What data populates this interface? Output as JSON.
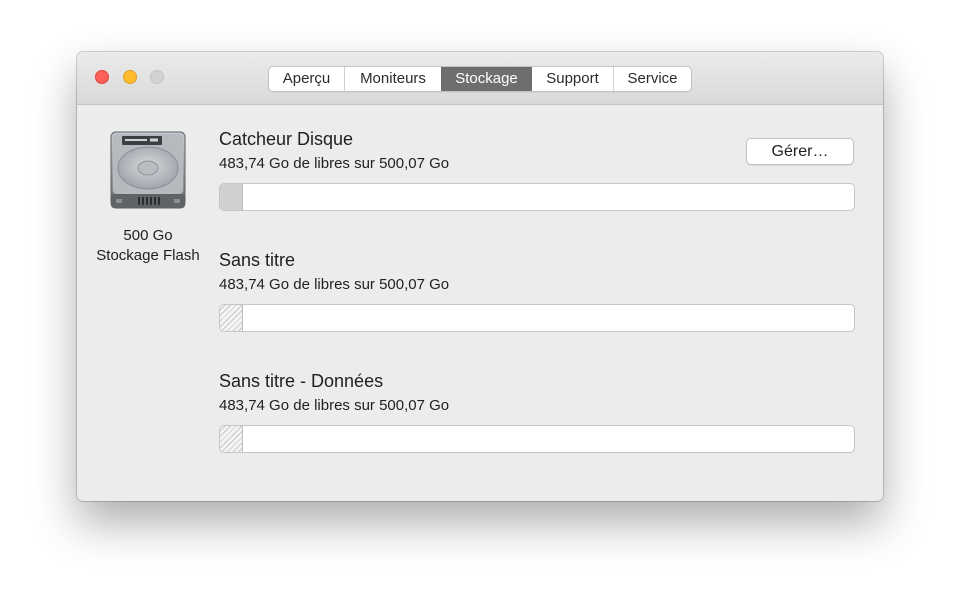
{
  "window": {
    "tabs": [
      {
        "label": "Aperçu",
        "active": false
      },
      {
        "label": "Moniteurs",
        "active": false
      },
      {
        "label": "Stockage",
        "active": true
      },
      {
        "label": "Support",
        "active": false
      },
      {
        "label": "Service",
        "active": false
      }
    ]
  },
  "drive": {
    "icon": "hard-drive-icon",
    "capacity": "500 Go",
    "type": "Stockage Flash"
  },
  "manage_button": {
    "label": "Gérer…"
  },
  "volumes": [
    {
      "name": "Catcheur Disque",
      "free_text": "483,74 Go de libres sur 500,07 Go",
      "used_fraction": 0.033
    },
    {
      "name": "Sans titre",
      "free_text": "483,74 Go de libres sur 500,07 Go",
      "used_fraction": 0.033
    },
    {
      "name": "Sans titre - Données",
      "free_text": "483,74 Go de libres sur 500,07 Go",
      "used_fraction": 0.033
    }
  ],
  "colors": {
    "close": "#fe5f57",
    "minimize": "#febc2e",
    "zoom_inactive": "#d3d3d3",
    "active_tab": "#6e6e6e"
  }
}
